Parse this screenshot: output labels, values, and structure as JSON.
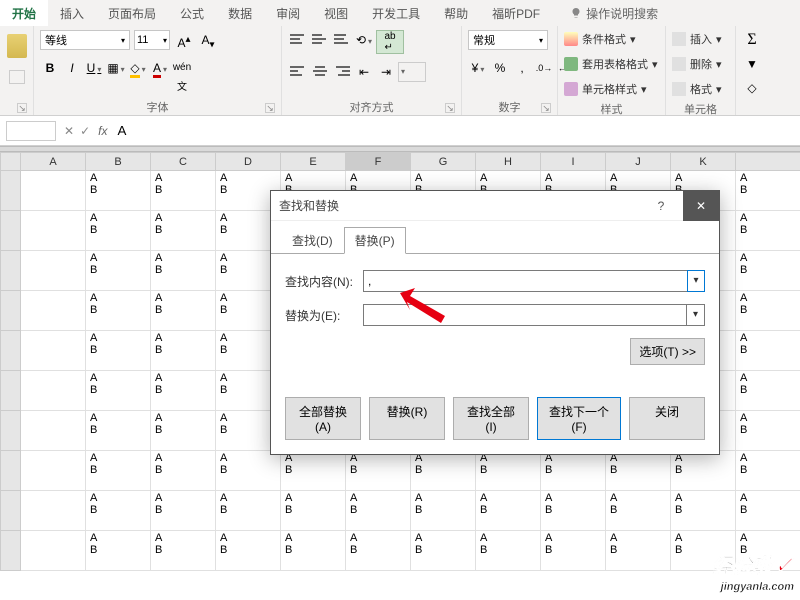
{
  "tabs": [
    "开始",
    "插入",
    "页面布局",
    "公式",
    "数据",
    "审阅",
    "视图",
    "开发工具",
    "帮助",
    "福昕PDF"
  ],
  "active_tab": 0,
  "tell_me": "操作说明搜索",
  "ribbon": {
    "clipboard_label": "",
    "font": {
      "label": "字体",
      "name": "等线",
      "size": "11",
      "bold": "B",
      "italic": "I",
      "underline": "U"
    },
    "alignment": {
      "label": "对齐方式"
    },
    "number": {
      "label": "数字",
      "format": "常规"
    },
    "styles": {
      "label": "样式",
      "conditional": "条件格式",
      "table": "套用表格格式",
      "cell": "单元格样式"
    },
    "cells": {
      "label": "单元格",
      "insert": "插入",
      "delete": "删除",
      "format": "格式"
    },
    "editing": {
      "sum": "Σ"
    }
  },
  "fx": {
    "label": "fx",
    "value": "A"
  },
  "columns": [
    "",
    "A",
    "B",
    "C",
    "D",
    "E",
    "F",
    "G",
    "H",
    "I",
    "J",
    "K",
    ""
  ],
  "selected_col": 5,
  "cell_data": "A\nB",
  "dialog": {
    "title": "查找和替换",
    "tab_find": "查找(D)",
    "tab_replace": "替换(P)",
    "find_label": "查找内容(N):",
    "replace_label": "替换为(E):",
    "find_value": ",",
    "replace_value": "",
    "options_btn": "选项(T) >>",
    "replace_all": "全部替换(A)",
    "replace_btn": "替换(R)",
    "find_all": "查找全部(I)",
    "find_next": "查找下一个(F)",
    "close_btn": "关闭"
  },
  "watermark_main": "经验啦",
  "watermark_site": "jingyanla.com"
}
